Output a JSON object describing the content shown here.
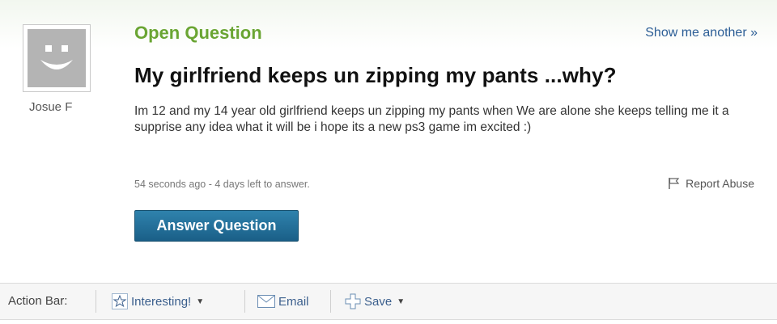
{
  "question": {
    "status": "Open Question",
    "title": "My girlfriend keeps un zipping my pants ...why?",
    "body": "Im 12 and my 14 year old girlfriend keeps un zipping my pants when We are alone she keeps telling me it a supprise any idea what it will be i hope its a new ps3 game im excited :)",
    "meta": "54 seconds ago - 4 days left to answer.",
    "asker": "Josue F"
  },
  "links": {
    "show_another": "Show me another »",
    "report_abuse": "Report Abuse"
  },
  "buttons": {
    "answer": "Answer Question"
  },
  "action_bar": {
    "label": "Action Bar:",
    "interesting": "Interesting!",
    "email": "Email",
    "save": "Save"
  },
  "colors": {
    "status_green": "#6aa533",
    "button_blue": "#1f6a94",
    "link_blue": "#2c5e96"
  }
}
